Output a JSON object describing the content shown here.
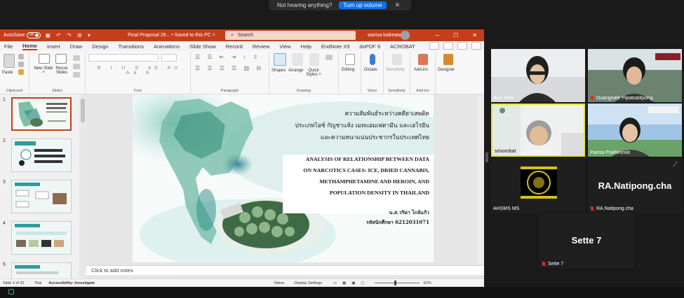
{
  "zoom": {
    "notice_text": "Not hearing anything?",
    "notice_button": "Turn up volume",
    "close": "✕"
  },
  "ppt": {
    "autosave_label": "AutoSave",
    "autosave_state": "Off",
    "doc_title": "Final Proposal 26...  •  Saved to this PC ˅",
    "search_placeholder": "Search",
    "user_name": "warisa kaikeaw",
    "menu": [
      "File",
      "Home",
      "Insert",
      "Draw",
      "Design",
      "Transitions",
      "Animations",
      "Slide Show",
      "Record",
      "Review",
      "View",
      "Help",
      "EndNote X9",
      "doPDF 9",
      "ACROBAT"
    ],
    "active_menu": "Home",
    "ribbon_groups": {
      "clipboard": "Clipboard",
      "slides": "Slides",
      "font": "Font",
      "paragraph": "Paragraph",
      "drawing": "Drawing",
      "voice": "Voice",
      "sensitivity": "Sensitivity",
      "addins": "Add-ins"
    },
    "ribbon_buttons": {
      "paste": "Paste",
      "new_slide": "New Slide ˅",
      "reuse_slides": "Reuse Slides",
      "shapes": "Shapes",
      "arrange": "Arrange",
      "quick_styles": "Quick Styles ˅",
      "editing": "Editing",
      "dictate": "Dictate",
      "sensitivity": "Sensitivity",
      "addins": "Add-ins",
      "designer": "Designer"
    },
    "slide_numbers": [
      "1",
      "2",
      "3",
      "4",
      "5"
    ],
    "slide": {
      "thai_title": [
        "ความสัมพันธ์ระหว่างคดียาเสพติด",
        "ประเภทไอซ์ กัญชาแห้ง เมทแอมเฟตามีน และเฮโรอีน",
        "และความหนาแน่นประชากรในประเทศไทย"
      ],
      "en_title": [
        "ANALYSIS OF RELATIONSHIP BETWEEN DATA",
        "ON NARCOTICS CASES: ICE, DRIED CANNABIS,",
        "METHAMPHETAMINE AND HEROIN, AND",
        "POPULATION DENSITY IN THAILAND"
      ],
      "author": "น.ส.วริษา ไกล้แก้ว",
      "student_id": "รหัสนักศึกษา 6212031071"
    },
    "notes_placeholder": "Click to add notes",
    "status": {
      "slide_count": "Slide 1 of 32",
      "language": "Thai",
      "accessibility": "Accessibility: Investigate",
      "notes": "Notes",
      "display": "Display Settings",
      "zoom_level": "62%"
    }
  },
  "participants": [
    {
      "name": "Bow Wari",
      "muted": false
    },
    {
      "name": "Duangnate Pipatsatitpong",
      "muted": true
    },
    {
      "name": "srisombat",
      "muted": false
    },
    {
      "name": "Pairoa Praihirunkit",
      "muted": false
    },
    {
      "name": "AHSMS MS",
      "muted": false
    },
    {
      "name": "RA.Natipong.cha",
      "muted": true,
      "avatar_text": "RA.Natipong.cha"
    },
    {
      "name": "Sette 7",
      "muted": true,
      "avatar_text": "Sette 7"
    }
  ]
}
